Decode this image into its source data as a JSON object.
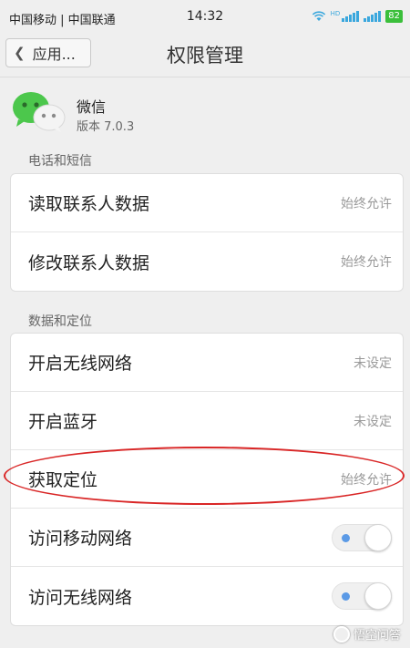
{
  "status_bar": {
    "carriers": "中国移动 | 中国联通",
    "time": "14:32",
    "battery": "82",
    "signal_hd": "HD"
  },
  "header": {
    "back_label": "应用...",
    "title": "权限管理"
  },
  "app": {
    "name": "微信",
    "version": "版本 7.0.3",
    "icon": "wechat-icon"
  },
  "sections": [
    {
      "title": "电话和短信",
      "items": [
        {
          "label": "读取联系人数据",
          "status": "始终允许"
        },
        {
          "label": "修改联系人数据",
          "status": "始终允许"
        }
      ]
    },
    {
      "title": "数据和定位",
      "items": [
        {
          "label": "开启无线网络",
          "status": "未设定"
        },
        {
          "label": "开启蓝牙",
          "status": "未设定"
        },
        {
          "label": "获取定位",
          "status": "始终允许"
        },
        {
          "label": "访问移动网络",
          "toggle": "on"
        },
        {
          "label": "访问无线网络",
          "toggle": "on"
        }
      ]
    }
  ],
  "annotation": {
    "color": "#d92626",
    "target": "获取定位"
  },
  "watermark": {
    "text": "悟空问答"
  },
  "colors": {
    "battery": "#3bbf3b",
    "signal": "#3aa7dd",
    "toggle_dot": "#5b9ae6"
  }
}
